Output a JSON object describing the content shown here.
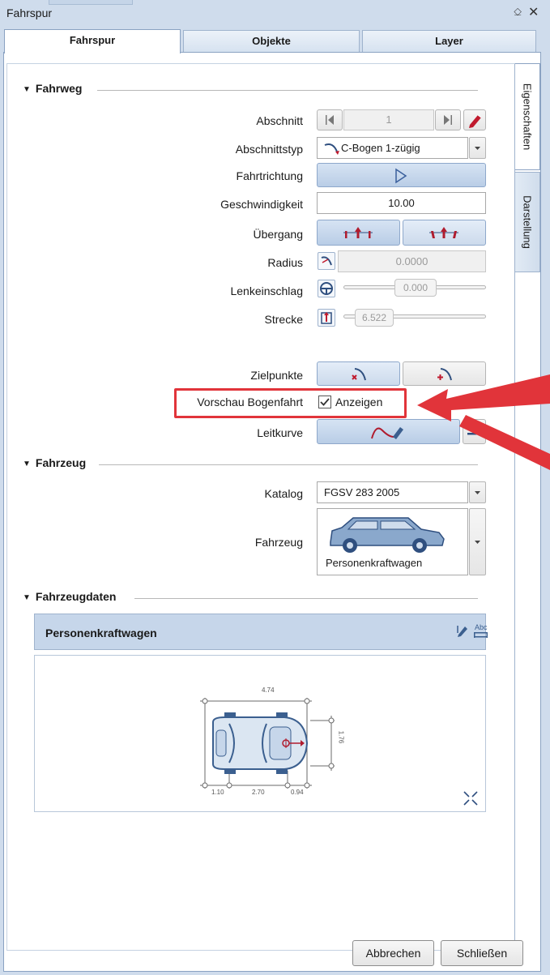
{
  "window": {
    "title": "Fahrspur",
    "pin_symbol": "⎐",
    "close_symbol": "✕"
  },
  "tabs": [
    {
      "label": "Fahrspur",
      "active": true
    },
    {
      "label": "Objekte",
      "active": false
    },
    {
      "label": "Layer",
      "active": false
    }
  ],
  "side_tabs": [
    {
      "label": "Eigenschaften",
      "active": true
    },
    {
      "label": "Darstellung",
      "active": false
    }
  ],
  "sections": {
    "fahrweg": "Fahrweg",
    "fahrzeug": "Fahrzeug",
    "fahrzeugdaten": "Fahrzeugdaten"
  },
  "fahrweg": {
    "abschnitt": {
      "label": "Abschnitt",
      "value": "1"
    },
    "abschnittstyp": {
      "label": "Abschnittstyp",
      "value": "C-Bogen 1-zügig"
    },
    "fahrtrichtung": {
      "label": "Fahrtrichtung"
    },
    "geschwindigkeit": {
      "label": "Geschwindigkeit",
      "value": "10.00"
    },
    "uebergang": {
      "label": "Übergang"
    },
    "radius": {
      "label": "Radius",
      "value": "0.0000"
    },
    "lenkeinschlag": {
      "label": "Lenkeinschlag",
      "value": "0.000"
    },
    "strecke": {
      "label": "Strecke",
      "value": "6.522"
    },
    "zielpunkte": {
      "label": "Zielpunkte"
    },
    "vorschau": {
      "label": "Vorschau Bogenfahrt",
      "checkbox_label": "Anzeigen",
      "checked": true
    },
    "leitkurve": {
      "label": "Leitkurve"
    }
  },
  "fahrzeug": {
    "katalog": {
      "label": "Katalog",
      "value": "FGSV 283 2005"
    },
    "fahrzeug": {
      "label": "Fahrzeug",
      "value": "Personenkraftwagen"
    }
  },
  "fahrzeugdaten": {
    "header": "Personenkraftwagen",
    "dims": {
      "length": "4.74",
      "width": "1.76",
      "front_overhang": "1.10",
      "wheelbase": "2.70",
      "rear_overhang": "0.94"
    }
  },
  "buttons": {
    "cancel": "Abbrechen",
    "close": "Schließen"
  },
  "colors": {
    "accent_blue": "#b9cde6",
    "highlight_red": "#e1343a",
    "icon_red": "#b01c2e",
    "header_blue": "#c6d6ea",
    "car_blue": "#3b5f8f"
  }
}
